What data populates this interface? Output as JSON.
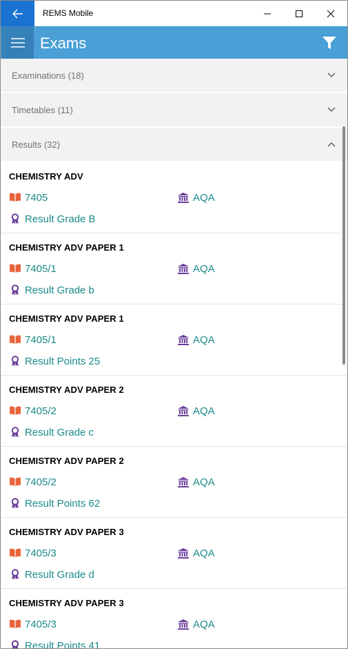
{
  "window": {
    "app_title": "REMS Mobile"
  },
  "header": {
    "title": "Exams"
  },
  "sections": [
    {
      "label": "Examinations (18)",
      "expanded": false
    },
    {
      "label": "Timetables (11)",
      "expanded": false
    },
    {
      "label": "Results (32)",
      "expanded": true
    }
  ],
  "results": [
    {
      "title": "CHEMISTRY ADV",
      "code": "7405",
      "board": "AQA",
      "result": "Result Grade B"
    },
    {
      "title": "CHEMISTRY ADV PAPER 1",
      "code": "7405/1",
      "board": "AQA",
      "result": "Result Grade b"
    },
    {
      "title": "CHEMISTRY ADV PAPER 1",
      "code": "7405/1",
      "board": "AQA",
      "result": "Result Points 25"
    },
    {
      "title": "CHEMISTRY ADV PAPER 2",
      "code": "7405/2",
      "board": "AQA",
      "result": "Result Grade c"
    },
    {
      "title": "CHEMISTRY ADV PAPER 2",
      "code": "7405/2",
      "board": "AQA",
      "result": "Result Points 62"
    },
    {
      "title": "CHEMISTRY ADV PAPER 3",
      "code": "7405/3",
      "board": "AQA",
      "result": "Result Grade d"
    },
    {
      "title": "CHEMISTRY ADV PAPER 3",
      "code": "7405/3",
      "board": "AQA",
      "result": "Result Points 41"
    }
  ],
  "icons": {
    "back": "arrow-left-icon",
    "minimize": "minimize-icon",
    "maximize": "maximize-icon",
    "close": "close-icon",
    "menu": "hamburger-menu-icon",
    "filter": "filter-icon",
    "collapsed": "chevron-down-icon",
    "expanded": "chevron-up-icon",
    "code": "book-icon",
    "board": "institution-icon",
    "result": "award-ribbon-icon"
  },
  "colors": {
    "titlebar_back": "#1a73d1",
    "appbar": "#4a9fd6",
    "hamburger_bg": "#3581b8",
    "section_bg": "#f2f2f2",
    "value_text": "#1b8a8a",
    "book_icon": "#e8643c",
    "board_icon": "#6a3d9a",
    "award_icon": "#6a3d9a"
  }
}
